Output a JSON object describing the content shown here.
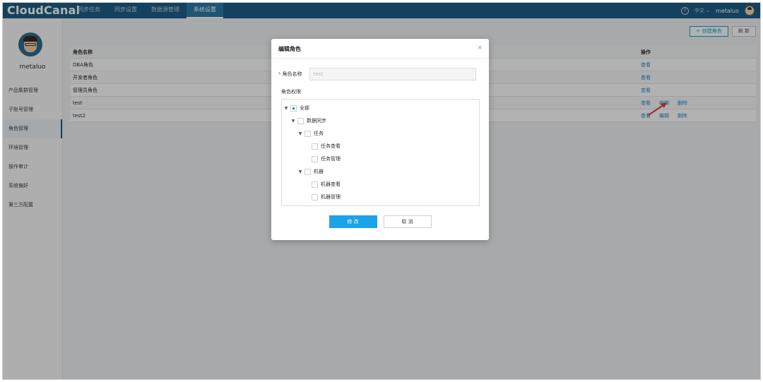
{
  "app": {
    "logo": "CloudCanal"
  },
  "topnav": {
    "items": [
      {
        "label": "同步任务",
        "active": false
      },
      {
        "label": "同步设置",
        "active": false
      },
      {
        "label": "数据源管理",
        "active": false
      },
      {
        "label": "系统设置",
        "active": true
      }
    ],
    "lang": "中文 ⌄",
    "user": "metaluo",
    "help_icon": "?"
  },
  "sidebar": {
    "username": "metaluo",
    "items": [
      {
        "label": "产品集群管理"
      },
      {
        "label": "子账号管理"
      },
      {
        "label": "角色管理",
        "active": true
      },
      {
        "label": "环境管理"
      },
      {
        "label": "操作审计"
      },
      {
        "label": "系统偏好"
      },
      {
        "label": "第三方配置"
      }
    ]
  },
  "toolbar": {
    "create_label": "＋ 创建角色",
    "refresh_label": "刷 新"
  },
  "table": {
    "headers": {
      "name": "角色名称",
      "actions": "操作"
    },
    "rows": [
      {
        "name": "DBA角色",
        "view": "查看",
        "edit": "",
        "delete": ""
      },
      {
        "name": "开发者角色",
        "view": "查看",
        "edit": "",
        "delete": ""
      },
      {
        "name": "管理员角色",
        "view": "查看",
        "edit": "",
        "delete": ""
      },
      {
        "name": "test",
        "view": "查看",
        "edit": "编辑",
        "delete": "删除"
      },
      {
        "name": "test2",
        "view": "查看",
        "edit": "编辑",
        "delete": "删除"
      }
    ]
  },
  "modal": {
    "title": "编辑角色",
    "close_icon": "×",
    "name_label": "角色名称",
    "required_mark": "*",
    "name_value": "test",
    "perm_label": "角色权限",
    "tree": [
      {
        "label": "全部",
        "level": 0,
        "expanded": true,
        "state": "partial"
      },
      {
        "label": "数据同步",
        "level": 1,
        "expanded": true,
        "state": "unchecked"
      },
      {
        "label": "任务",
        "level": 2,
        "expanded": true,
        "state": "unchecked"
      },
      {
        "label": "任务查看",
        "level": 3,
        "state": "unchecked"
      },
      {
        "label": "任务管理",
        "level": 3,
        "state": "unchecked"
      },
      {
        "label": "机器",
        "level": 2,
        "expanded": true,
        "state": "unchecked"
      },
      {
        "label": "机器查看",
        "level": 3,
        "state": "unchecked"
      },
      {
        "label": "机器管理",
        "level": 3,
        "state": "unchecked"
      }
    ],
    "ok_label": "修 改",
    "cancel_label": "取 消"
  },
  "colors": {
    "topbar": "#1d5f87",
    "accent": "#1aa3e8",
    "link": "#2b89c8",
    "arrow": "#e0413a"
  }
}
